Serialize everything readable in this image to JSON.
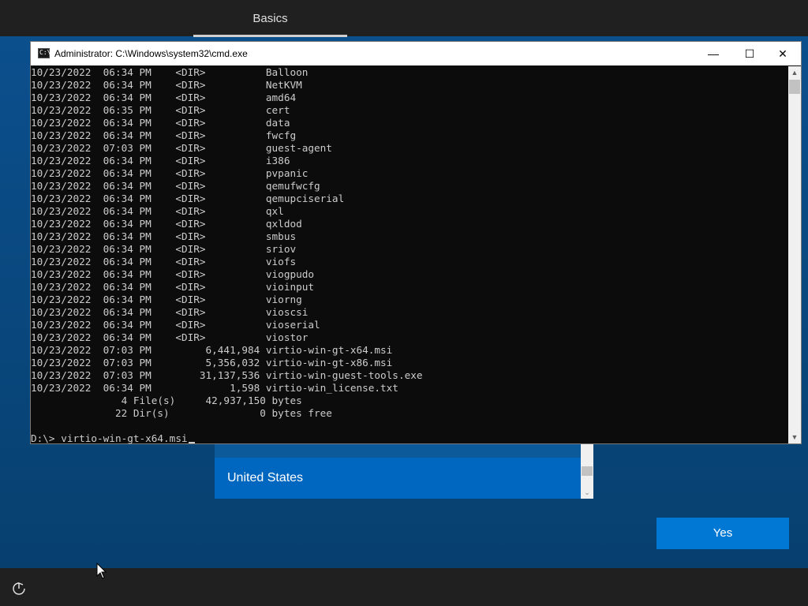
{
  "oobe": {
    "tab_label": "Basics",
    "region_selected": "United States",
    "yes_label": "Yes"
  },
  "cmd": {
    "title": "Administrator: C:\\Windows\\system32\\cmd.exe",
    "minimize_glyph": "—",
    "maximize_glyph": "☐",
    "close_glyph": "✕",
    "lines": [
      "10/23/2022  06:34 PM    <DIR>          Balloon",
      "10/23/2022  06:34 PM    <DIR>          NetKVM",
      "10/23/2022  06:34 PM    <DIR>          amd64",
      "10/23/2022  06:35 PM    <DIR>          cert",
      "10/23/2022  06:34 PM    <DIR>          data",
      "10/23/2022  06:34 PM    <DIR>          fwcfg",
      "10/23/2022  07:03 PM    <DIR>          guest-agent",
      "10/23/2022  06:34 PM    <DIR>          i386",
      "10/23/2022  06:34 PM    <DIR>          pvpanic",
      "10/23/2022  06:34 PM    <DIR>          qemufwcfg",
      "10/23/2022  06:34 PM    <DIR>          qemupciserial",
      "10/23/2022  06:34 PM    <DIR>          qxl",
      "10/23/2022  06:34 PM    <DIR>          qxldod",
      "10/23/2022  06:34 PM    <DIR>          smbus",
      "10/23/2022  06:34 PM    <DIR>          sriov",
      "10/23/2022  06:34 PM    <DIR>          viofs",
      "10/23/2022  06:34 PM    <DIR>          viogpudo",
      "10/23/2022  06:34 PM    <DIR>          vioinput",
      "10/23/2022  06:34 PM    <DIR>          viorng",
      "10/23/2022  06:34 PM    <DIR>          vioscsi",
      "10/23/2022  06:34 PM    <DIR>          vioserial",
      "10/23/2022  06:34 PM    <DIR>          viostor",
      "10/23/2022  07:03 PM         6,441,984 virtio-win-gt-x64.msi",
      "10/23/2022  07:03 PM         5,356,032 virtio-win-gt-x86.msi",
      "10/23/2022  07:03 PM        31,137,536 virtio-win-guest-tools.exe",
      "10/23/2022  06:34 PM             1,598 virtio-win_license.txt",
      "               4 File(s)     42,937,150 bytes",
      "              22 Dir(s)               0 bytes free",
      ""
    ],
    "prompt": "D:\\> virtio-win-gt-x64.msi"
  }
}
